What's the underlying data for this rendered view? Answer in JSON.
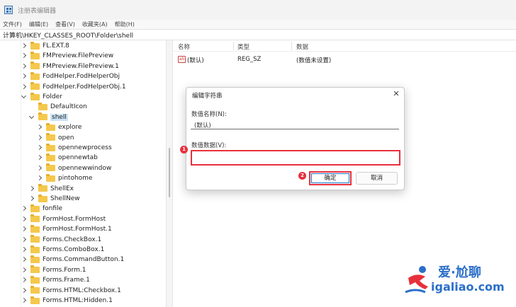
{
  "window": {
    "title": "注册表编辑器"
  },
  "menu": [
    "文件(F)",
    "编辑(E)",
    "查看(V)",
    "收藏夹(A)",
    "帮助(H)"
  ],
  "address": "计算机\\HKEY_CLASSES_ROOT\\Folder\\shell",
  "tree": [
    {
      "label": "FL.EXT.8",
      "expander": "right",
      "level": 0
    },
    {
      "label": "FMPreview.FilePreview",
      "expander": "right",
      "level": 0
    },
    {
      "label": "FMPreview.FilePreview.1",
      "expander": "right",
      "level": 0
    },
    {
      "label": "FodHelper.FodHelperObj",
      "expander": "right",
      "level": 0
    },
    {
      "label": "FodHelper.FodHelperObj.1",
      "expander": "right",
      "level": 0
    },
    {
      "label": "Folder",
      "expander": "down",
      "level": 0
    },
    {
      "label": "DefaultIcon",
      "expander": "none",
      "level": 1
    },
    {
      "label": "shell",
      "expander": "down",
      "level": 1,
      "selected": true
    },
    {
      "label": "explore",
      "expander": "right",
      "level": 2
    },
    {
      "label": "open",
      "expander": "right",
      "level": 2
    },
    {
      "label": "opennewprocess",
      "expander": "right",
      "level": 2
    },
    {
      "label": "opennewtab",
      "expander": "right",
      "level": 2
    },
    {
      "label": "opennewwindow",
      "expander": "right",
      "level": 2
    },
    {
      "label": "pintohome",
      "expander": "right",
      "level": 2
    },
    {
      "label": "ShellEx",
      "expander": "right",
      "level": 1
    },
    {
      "label": "ShellNew",
      "expander": "right",
      "level": 1
    },
    {
      "label": "fonfile",
      "expander": "right",
      "level": 0
    },
    {
      "label": "FormHost.FormHost",
      "expander": "right",
      "level": 0
    },
    {
      "label": "FormHost.FormHost.1",
      "expander": "right",
      "level": 0
    },
    {
      "label": "Forms.CheckBox.1",
      "expander": "right",
      "level": 0
    },
    {
      "label": "Forms.ComboBox.1",
      "expander": "right",
      "level": 0
    },
    {
      "label": "Forms.CommandButton.1",
      "expander": "right",
      "level": 0
    },
    {
      "label": "Forms.Form.1",
      "expander": "right",
      "level": 0
    },
    {
      "label": "Forms.Frame.1",
      "expander": "right",
      "level": 0
    },
    {
      "label": "Forms.HTML:Checkbox.1",
      "expander": "right",
      "level": 0
    },
    {
      "label": "Forms.HTML:Hidden.1",
      "expander": "right",
      "level": 0
    }
  ],
  "list": {
    "columns": {
      "name": "名称",
      "type": "类型",
      "data": "数据"
    },
    "rows": [
      {
        "icon": "ab",
        "name": "(默认)",
        "type": "REG_SZ",
        "data": "(数值未设置)"
      }
    ]
  },
  "dialog": {
    "title": "编辑字符串",
    "close_glyph": "✕",
    "value_name_label": "数值名称(N):",
    "value_name": "(默认)",
    "value_data_label": "数值数据(V):",
    "value_data": "",
    "ok_label": "确定",
    "cancel_label": "取消"
  },
  "callouts": {
    "one": "1",
    "two": "2"
  },
  "watermark": {
    "line1": "爱·尬聊",
    "line2": "igaliao.com"
  },
  "colors": {
    "highlight": "#e8303c",
    "selection": "#cce4f7",
    "folder": "#f5c84c",
    "brand": "#2a6fc9"
  }
}
